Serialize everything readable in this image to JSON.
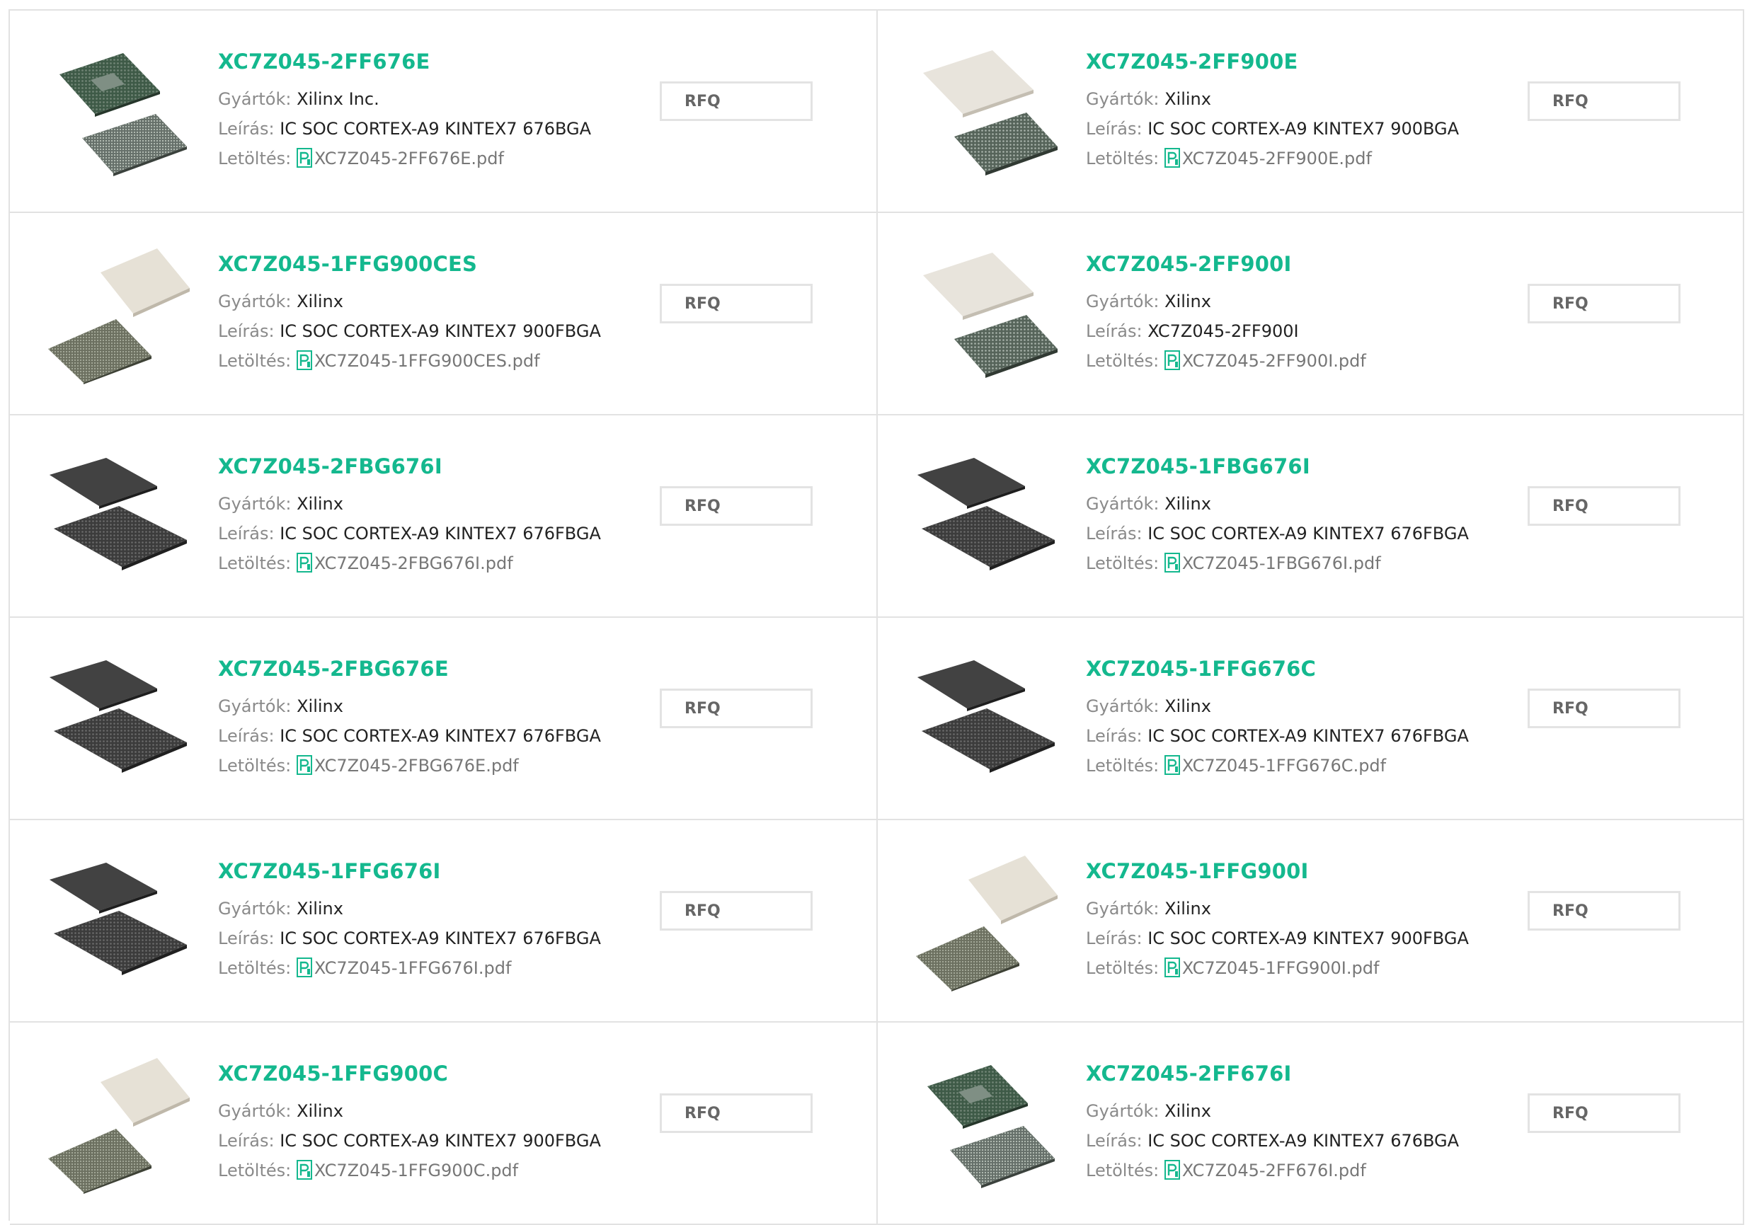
{
  "labels": {
    "manufacturer": "Gyártók:",
    "description": "Leírás:",
    "download": "Letöltés:",
    "rfq": "RFQ"
  },
  "colors": {
    "accent": "#14b88e",
    "border": "#e2e2e2"
  },
  "products": [
    {
      "name": "XC7Z045-2FF676E",
      "manufacturer": "Xilinx Inc.",
      "description": "IC SOC CORTEX-A9 KINTEX7 676BGA",
      "pdf": "XC7Z045-2FF676E.pdf",
      "image": "green-bga-chip"
    },
    {
      "name": "XC7Z045-2FF900E",
      "manufacturer": "Xilinx",
      "description": "IC SOC CORTEX-A9 KINTEX7 900BGA",
      "pdf": "XC7Z045-2FF900E.pdf",
      "image": "beige-bga-chip"
    },
    {
      "name": "XC7Z045-1FFG900CES",
      "manufacturer": "Xilinx",
      "description": "IC SOC CORTEX-A9 KINTEX7 900FBGA",
      "pdf": "XC7Z045-1FFG900CES.pdf",
      "image": "beige-bga-chip-large"
    },
    {
      "name": "XC7Z045-2FF900I",
      "manufacturer": "Xilinx",
      "description": "XC7Z045-2FF900I",
      "pdf": "XC7Z045-2FF900I.pdf",
      "image": "beige-bga-chip"
    },
    {
      "name": "XC7Z045-2FBG676I",
      "manufacturer": "Xilinx",
      "description": "IC SOC CORTEX-A9 KINTEX7 676FBGA",
      "pdf": "XC7Z045-2FBG676I.pdf",
      "image": "dark-bga-chip"
    },
    {
      "name": "XC7Z045-1FBG676I",
      "manufacturer": "Xilinx",
      "description": "IC SOC CORTEX-A9 KINTEX7 676FBGA",
      "pdf": "XC7Z045-1FBG676I.pdf",
      "image": "dark-bga-chip"
    },
    {
      "name": "XC7Z045-2FBG676E",
      "manufacturer": "Xilinx",
      "description": "IC SOC CORTEX-A9 KINTEX7 676FBGA",
      "pdf": "XC7Z045-2FBG676E.pdf",
      "image": "dark-bga-chip"
    },
    {
      "name": "XC7Z045-1FFG676C",
      "manufacturer": "Xilinx",
      "description": "IC SOC CORTEX-A9 KINTEX7 676FBGA",
      "pdf": "XC7Z045-1FFG676C.pdf",
      "image": "dark-bga-chip"
    },
    {
      "name": "XC7Z045-1FFG676I",
      "manufacturer": "Xilinx",
      "description": "IC SOC CORTEX-A9 KINTEX7 676FBGA",
      "pdf": "XC7Z045-1FFG676I.pdf",
      "image": "dark-bga-chip"
    },
    {
      "name": "XC7Z045-1FFG900I",
      "manufacturer": "Xilinx",
      "description": "IC SOC CORTEX-A9 KINTEX7 900FBGA",
      "pdf": "XC7Z045-1FFG900I.pdf",
      "image": "beige-bga-chip-large"
    },
    {
      "name": "XC7Z045-1FFG900C",
      "manufacturer": "Xilinx",
      "description": "IC SOC CORTEX-A9 KINTEX7 900FBGA",
      "pdf": "XC7Z045-1FFG900C.pdf",
      "image": "beige-bga-chip-large"
    },
    {
      "name": "XC7Z045-2FF676I",
      "manufacturer": "Xilinx",
      "description": "IC SOC CORTEX-A9 KINTEX7 676BGA",
      "pdf": "XC7Z045-2FF676I.pdf",
      "image": "green-bga-chip"
    }
  ]
}
